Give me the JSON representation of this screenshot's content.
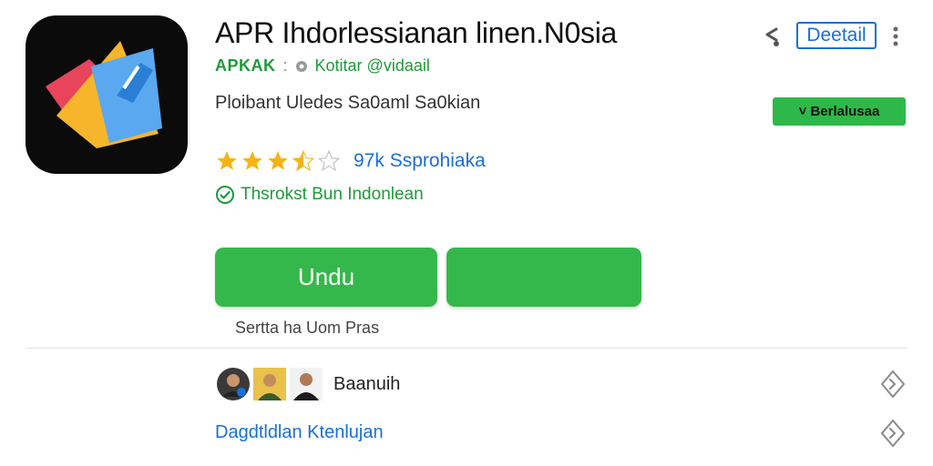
{
  "app": {
    "title": "APR Ihdorlessianan linen.N0sia",
    "developer": "APKAK",
    "separator": ":",
    "developer_sub": "Kotitar @vidaail",
    "category": "Ploibant  Uledes Sa0aml Sa0kian",
    "rating_value": 3.5,
    "review_count": "97k Ssprohiaka",
    "verified_text": "Thsrokst Bun Indonlean"
  },
  "header": {
    "detail_label": "Deetail",
    "share_icon": "share-icon",
    "more_icon": "more-vert-icon"
  },
  "actions": {
    "install_small_label": "Berlalusaa",
    "primary_label": "Undu",
    "secondary_label": "",
    "caption": "Sertta ha Uom Pras"
  },
  "social": {
    "label": "Baanuih",
    "avatar_count": 3
  },
  "footer": {
    "link_label": "Dagdtldlan Ktenlujan"
  },
  "colors": {
    "accent_green": "#35b84b",
    "link_blue": "#1a6fd6",
    "star_gold": "#f5b316"
  }
}
